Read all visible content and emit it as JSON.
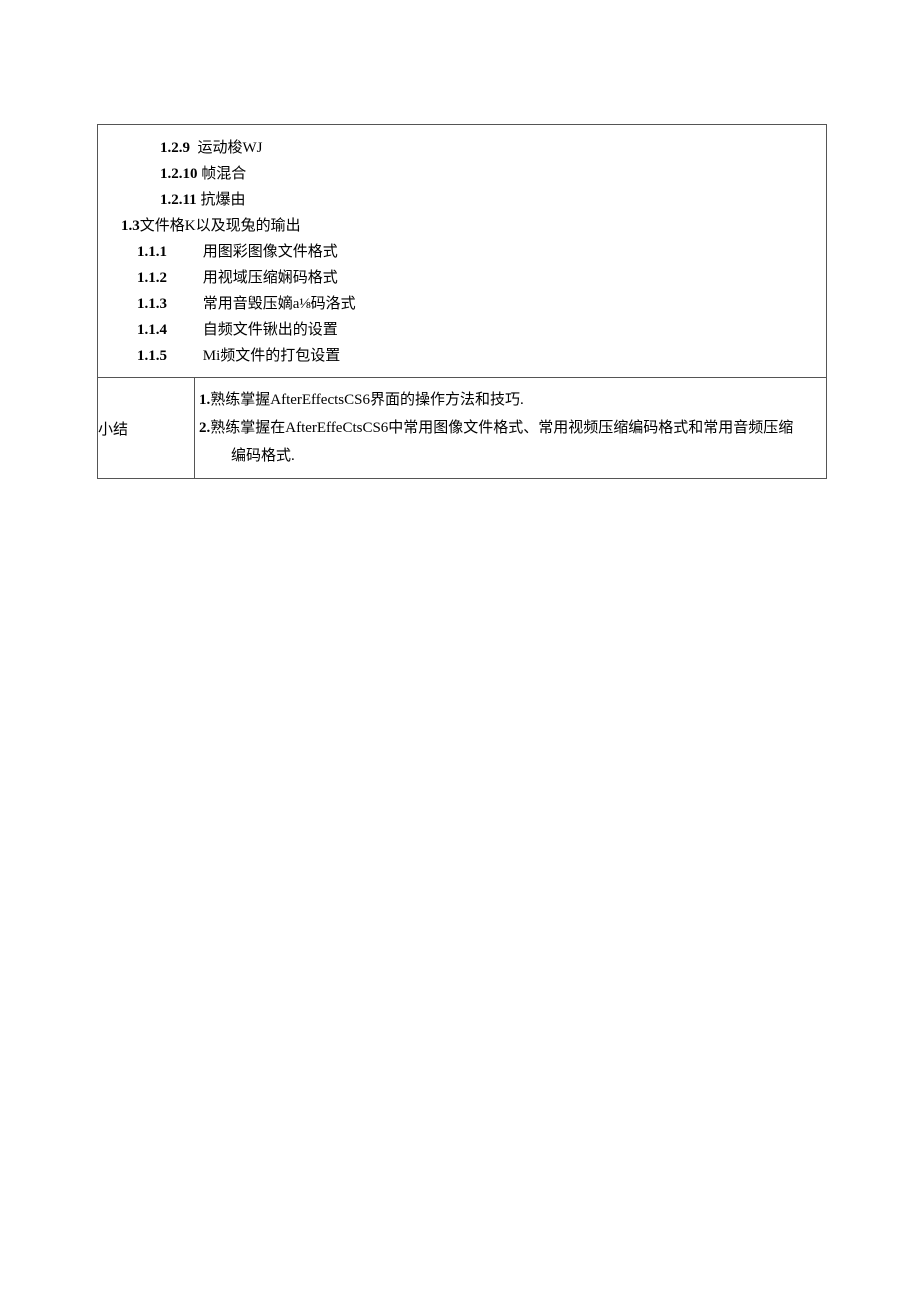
{
  "outline": {
    "i129": {
      "num": "1.2.9",
      "text": "运动梭WJ"
    },
    "i1210": {
      "num": "1.2.10",
      "text": "帧混合"
    },
    "i1211": {
      "num": "1.2.11",
      "text": "抗爆由"
    },
    "sec13": {
      "num": "1.3",
      "text": "文件格K以及现兔的瑜出"
    },
    "i111": {
      "num": "1.1.1",
      "text": "用图彩图像文件格式"
    },
    "i112": {
      "num": "1.1.2",
      "text": "用视域压缩娴码格式"
    },
    "i113": {
      "num": "1.1.3",
      "text": "常用音毁压嫡a⅛码洛式"
    },
    "i114": {
      "num": "1.1.4",
      "text": "自频文件锹出的设置"
    },
    "i115": {
      "num": "1.1.5",
      "text": "Mi频文件的打包设置"
    }
  },
  "summary": {
    "label": "小结",
    "p1_num": "1.",
    "p1_text": "熟练掌握AfterEffectsCS6界面的操作方法和技巧.",
    "p2_num": "2.",
    "p2_text": "熟练掌握在AfterEffeCtsCS6中常用图像文件格式、常用视频压缩编码格式和常用音频压缩",
    "p2_cont": "编码格式."
  }
}
